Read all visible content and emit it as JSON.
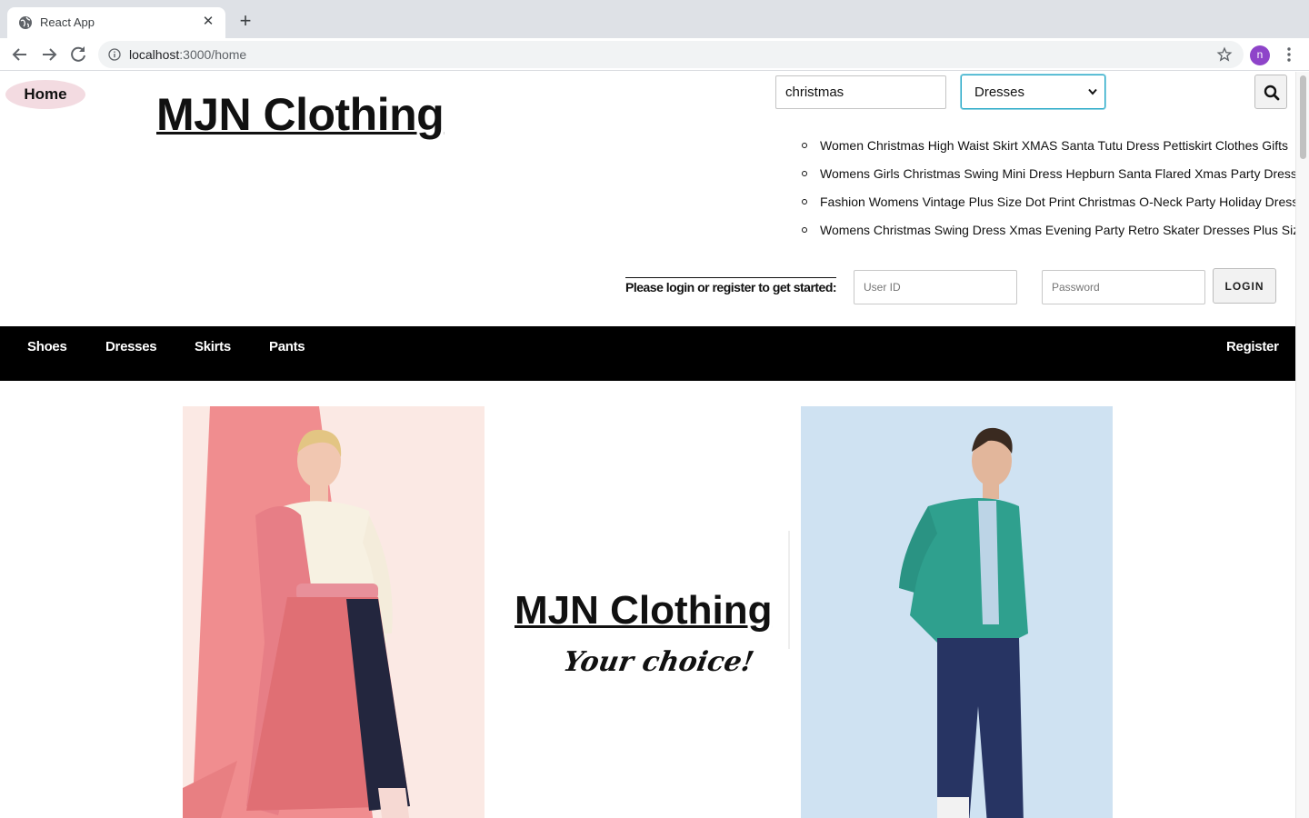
{
  "browser": {
    "tab_title": "React App",
    "url_host": "localhost",
    "url_rest": ":3000/home",
    "profile_initial": "n"
  },
  "header": {
    "home_label": "Home",
    "brand": "MJN Clothing"
  },
  "search": {
    "query": "christmas",
    "category_selected": "Dresses",
    "results": [
      "Women Christmas High Waist Skirt XMAS Santa Tutu Dress Pettiskirt Clothes Gifts",
      "Womens Girls Christmas Swing Mini Dress Hepburn Santa Flared Xmas Party Dresses",
      "Fashion Womens Vintage Plus Size Dot Print Christmas O-Neck Party Holiday Dress",
      "Womens Christmas Swing Dress Xmas Evening Party Retro Skater Dresses Plus Size"
    ]
  },
  "login": {
    "prompt": "Please login or register to get started:",
    "user_placeholder": "User ID",
    "password_placeholder": "Password",
    "button": "LOGIN"
  },
  "nav": {
    "items": [
      "Shoes",
      "Dresses",
      "Skirts",
      "Pants"
    ],
    "register": "Register"
  },
  "hero": {
    "brand": "MJN Clothing",
    "tagline": "Your choice!"
  },
  "colors": {
    "navbar": "#000000",
    "home_pill": "#f3dbe1",
    "select_focus": "#28a9c7"
  }
}
